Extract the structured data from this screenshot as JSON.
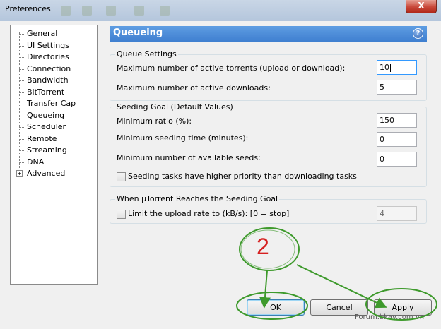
{
  "window": {
    "title": "Preferences",
    "close_glyph": "X"
  },
  "sidebar": {
    "items": [
      {
        "label": "General"
      },
      {
        "label": "UI Settings"
      },
      {
        "label": "Directories"
      },
      {
        "label": "Connection"
      },
      {
        "label": "Bandwidth"
      },
      {
        "label": "BitTorrent"
      },
      {
        "label": "Transfer Cap"
      },
      {
        "label": "Queueing",
        "selected": true
      },
      {
        "label": "Scheduler"
      },
      {
        "label": "Remote"
      },
      {
        "label": "Streaming"
      },
      {
        "label": "DNA"
      },
      {
        "label": "Advanced",
        "expandable": true
      }
    ],
    "expander_glyph": "+"
  },
  "header": {
    "title": "Queueing",
    "help_glyph": "?",
    "color": "#4a8ad8"
  },
  "queue_settings": {
    "title": "Queue Settings",
    "max_active_torrents_label": "Maximum number of active torrents (upload or download):",
    "max_active_torrents_value": "10",
    "max_active_downloads_label": "Maximum number of active downloads:",
    "max_active_downloads_value": "5"
  },
  "seeding_goal": {
    "title": "Seeding Goal (Default Values)",
    "min_ratio_label": "Minimum ratio (%):",
    "min_ratio_value": "150",
    "min_seeding_time_label": "Minimum seeding time (minutes):",
    "min_seeding_time_value": "0",
    "min_available_seeds_label": "Minimum number of available seeds:",
    "min_available_seeds_value": "0",
    "priority_checkbox_label": "Seeding tasks have higher priority than downloading tasks",
    "priority_checked": false
  },
  "when_reached": {
    "title": "When µTorrent Reaches the Seeding Goal",
    "limit_label": "Limit the upload rate to (kB/s): [0 = stop]",
    "limit_checked": false,
    "limit_value": "4"
  },
  "buttons": {
    "ok": "OK",
    "cancel": "Cancel",
    "apply": "Apply"
  },
  "annotation": {
    "number": "2",
    "circle_color": "#3e9a2c",
    "number_color": "#d62020"
  },
  "watermark": "Forum.bkav.com.vn"
}
